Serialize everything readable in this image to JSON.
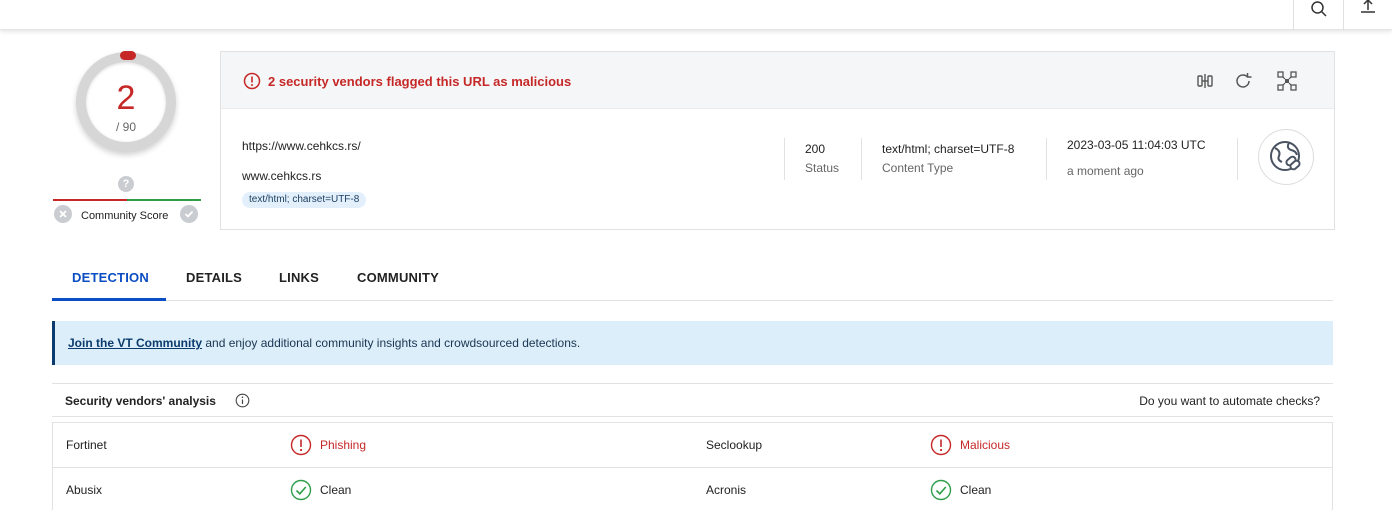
{
  "colors": {
    "malicious": "#c62828",
    "clean": "#2e9e4a",
    "accent": "#0b4dc2",
    "banner_bg": "#dbeef9"
  },
  "topbar": {
    "search_icon": "search-icon",
    "upload_icon": "upload-icon"
  },
  "score": {
    "detections": "2",
    "total": "/ 90",
    "community_label": "Community Score",
    "community_value": "?"
  },
  "alert": {
    "text": "2 security vendors flagged this URL as malicious"
  },
  "header_actions": [
    "compare-icon",
    "reanalyze-icon",
    "graph-icon"
  ],
  "target": {
    "url": "https://www.cehkcs.rs/",
    "domain": "www.cehkcs.rs",
    "tag": "text/html; charset=UTF-8"
  },
  "meta": {
    "status_value": "200",
    "status_label": "Status",
    "content_type_value": "text/html; charset=UTF-8",
    "content_type_label": "Content Type",
    "date_value": "2023-03-05 11:04:03 UTC",
    "date_label": "a moment ago"
  },
  "tabs": [
    {
      "label": "DETECTION",
      "active": true
    },
    {
      "label": "DETAILS"
    },
    {
      "label": "LINKS"
    },
    {
      "label": "COMMUNITY"
    }
  ],
  "banner": {
    "link": "Join the VT Community",
    "text": " and enjoy additional community insights and crowdsourced detections."
  },
  "analysis": {
    "title": "Security vendors' analysis",
    "automate": "Do you want to automate checks?"
  },
  "vendors": [
    [
      {
        "name": "Fortinet",
        "result": "Phishing",
        "status": "malicious"
      },
      {
        "name": "Seclookup",
        "result": "Malicious",
        "status": "malicious"
      }
    ],
    [
      {
        "name": "Abusix",
        "result": "Clean",
        "status": "clean"
      },
      {
        "name": "Acronis",
        "result": "Clean",
        "status": "clean"
      }
    ]
  ]
}
